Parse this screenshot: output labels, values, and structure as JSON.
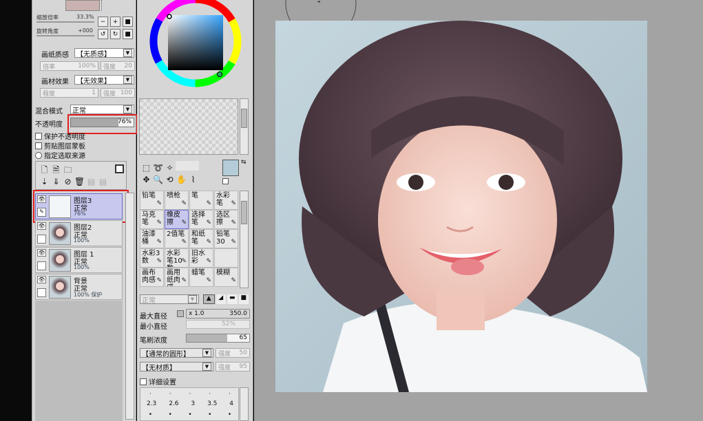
{
  "left_panel": {
    "zoom_label": "缩放倍率",
    "zoom_value": "33.3%",
    "rotate_label": "旋转角度",
    "rotate_value": "+000",
    "paper_texture_label": "画纸质感",
    "paper_texture_value": "【无质感】",
    "scale_label": "倍率",
    "scale_value": "100%",
    "strength_label": "强度",
    "strength_value": "20",
    "material_effect_label": "画材效果",
    "material_effect_value": "【无效果】",
    "degree_label": "程度",
    "degree_value": "1",
    "strength2_label": "强度",
    "strength2_value": "100",
    "blend_mode_label": "混合模式",
    "blend_mode_value": "正常",
    "opacity_label": "不透明度",
    "opacity_value": "76%",
    "opacity_fraction": 0.76,
    "protect_opacity_label": "保护不透明度",
    "clip_group_label": "剪贴图层蒙板",
    "selection_source_label": "指定选取来源",
    "layers": [
      {
        "name": "图层3",
        "mode": "正常",
        "opacity": "76%",
        "selected": true
      },
      {
        "name": "图层2",
        "mode": "正常",
        "opacity": "100%",
        "selected": false
      },
      {
        "name": "图层 1",
        "mode": "正常",
        "opacity": "100%",
        "selected": false
      },
      {
        "name": "背景",
        "mode": "正常",
        "opacity": "100% 保护",
        "selected": false
      }
    ]
  },
  "tool_panel": {
    "tools": [
      [
        "铅笔",
        "喷枪",
        "笔",
        "水彩笔"
      ],
      [
        "马克笔",
        "橡皮擦",
        "选择笔",
        "选区擦"
      ],
      [
        "油漆桶",
        "2值笔",
        "和纸笔",
        "铅笔30"
      ],
      [
        "水彩3数",
        "水彩笔10数",
        "旧水彩",
        ""
      ],
      [
        "画布肉感",
        "画用纸肉感",
        "蜡笔",
        "模糊"
      ]
    ],
    "selected_tool": "橡皮擦",
    "mode_value": "正常",
    "max_size_label": "最大直径",
    "max_size_mult": "x 1.0",
    "max_size_value": "350.0",
    "min_size_label": "最小直径",
    "min_size_value": "52%",
    "density_label": "笔刷浓度",
    "density_value": "65",
    "shape_value": "【通常的圆形】",
    "shape_strength_label": "强度",
    "shape_strength_value": "50",
    "texture_value": "【无材质】",
    "texture_strength_label": "强度",
    "texture_strength_value": "95",
    "detail_label": "详细设置",
    "size_presets": [
      "2.3",
      "2.6",
      "3",
      "3.5",
      "4"
    ]
  },
  "colors": {
    "selection_red": "#e02020",
    "selected_layer_bg": "#c8c8ee",
    "panel_bg": "#d6d6d6",
    "canvas_bg": "#a3a3a3",
    "foreground_color": "#b4ccd8"
  }
}
